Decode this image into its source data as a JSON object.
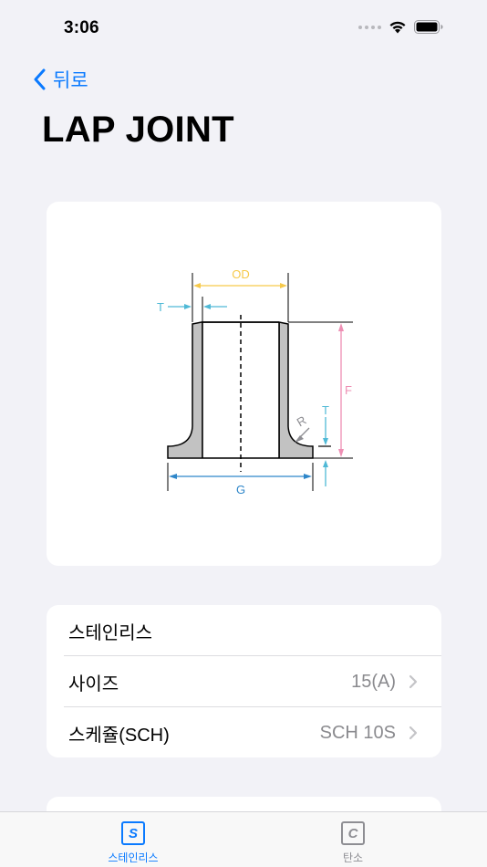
{
  "status": {
    "time": "3:06"
  },
  "nav": {
    "back_label": "뒤로"
  },
  "page": {
    "title": "LAP JOINT"
  },
  "diagram": {
    "labels": {
      "od": "OD",
      "t_top": "T",
      "t_right": "T",
      "f": "F",
      "r": "R",
      "g": "G"
    },
    "colors": {
      "od": "#f6c94a",
      "t": "#4fb9d6",
      "f": "#ee8fb4",
      "g": "#2e86c9",
      "body": "#c2c2c2",
      "outline": "#000000"
    }
  },
  "settings": {
    "material_label": "스테인리스",
    "size_label": "사이즈",
    "size_value": "15(A)",
    "schedule_label": "스케쥴(SCH)",
    "schedule_value": "SCH 10S"
  },
  "tabs": [
    {
      "icon": "S",
      "label": "스테인리스",
      "color": "#0a7aff"
    },
    {
      "icon": "C",
      "label": "탄소",
      "color": "#8e8e93"
    }
  ]
}
